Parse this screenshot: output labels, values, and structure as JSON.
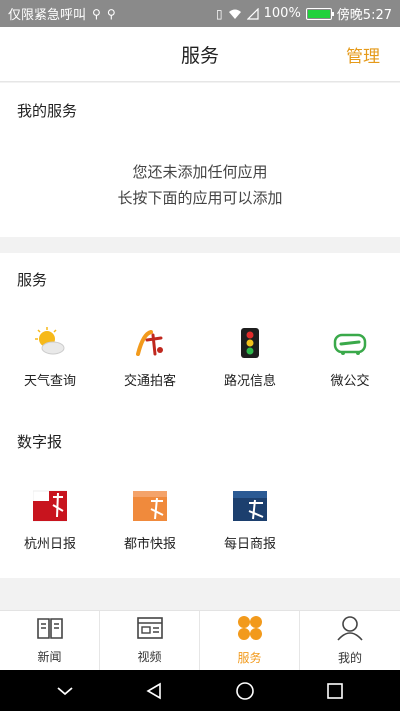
{
  "status_bar": {
    "carrier": "仅限紧急呼叫",
    "battery": "100%",
    "time": "傍晚5:27"
  },
  "header": {
    "title": "服务",
    "manage": "管理"
  },
  "my_services": {
    "title": "我的服务",
    "empty_line1": "您还未添加任何应用",
    "empty_line2": "长按下面的应用可以添加"
  },
  "services": {
    "title": "服务",
    "items": [
      {
        "label": "天气查询",
        "icon": "weather-icon"
      },
      {
        "label": "交通拍客",
        "icon": "traffic-photo-icon"
      },
      {
        "label": "路况信息",
        "icon": "traffic-light-icon"
      },
      {
        "label": "微公交",
        "icon": "micro-bus-icon"
      }
    ]
  },
  "digital_newspaper": {
    "title": "数字报",
    "items": [
      {
        "label": "杭州日报",
        "icon": "hangzhou-daily-icon",
        "color": "#c8141e"
      },
      {
        "label": "都市快报",
        "icon": "city-express-icon",
        "color": "#f08a3c"
      },
      {
        "label": "每日商报",
        "icon": "daily-business-icon",
        "color": "#1c3f6e"
      }
    ]
  },
  "tabs": [
    {
      "label": "新闻",
      "icon": "book-icon"
    },
    {
      "label": "视频",
      "icon": "video-icon"
    },
    {
      "label": "服务",
      "icon": "clover-icon",
      "active": true
    },
    {
      "label": "我的",
      "icon": "person-icon"
    }
  ],
  "colors": {
    "accent": "#f29a1c",
    "manage": "#e59a1a"
  }
}
